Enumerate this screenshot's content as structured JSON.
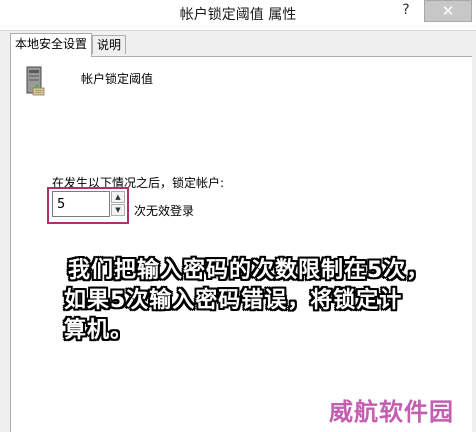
{
  "window": {
    "title": "帐户锁定阈值 属性",
    "help_label": "?",
    "close_label": "✕"
  },
  "tabs": [
    {
      "label": "本地安全设置",
      "active": true
    },
    {
      "label": "说明",
      "active": false
    }
  ],
  "policy": {
    "icon": "server-icon",
    "name": "帐户锁定阈值"
  },
  "threshold": {
    "label": "在发生以下情况之后，锁定帐户:",
    "value": "5",
    "suffix": "次无效登录",
    "up_arrow": "▲",
    "down_arrow": "▼"
  },
  "annotation": {
    "line1": "我们把输入密码的次数限制在5次，",
    "line2": "如果5次输入密码错误，将锁定计",
    "line3": "算机。",
    "highlight_color": "#b0306a"
  },
  "watermark": {
    "text": "威航软件园",
    "color": "#c25fb0"
  }
}
